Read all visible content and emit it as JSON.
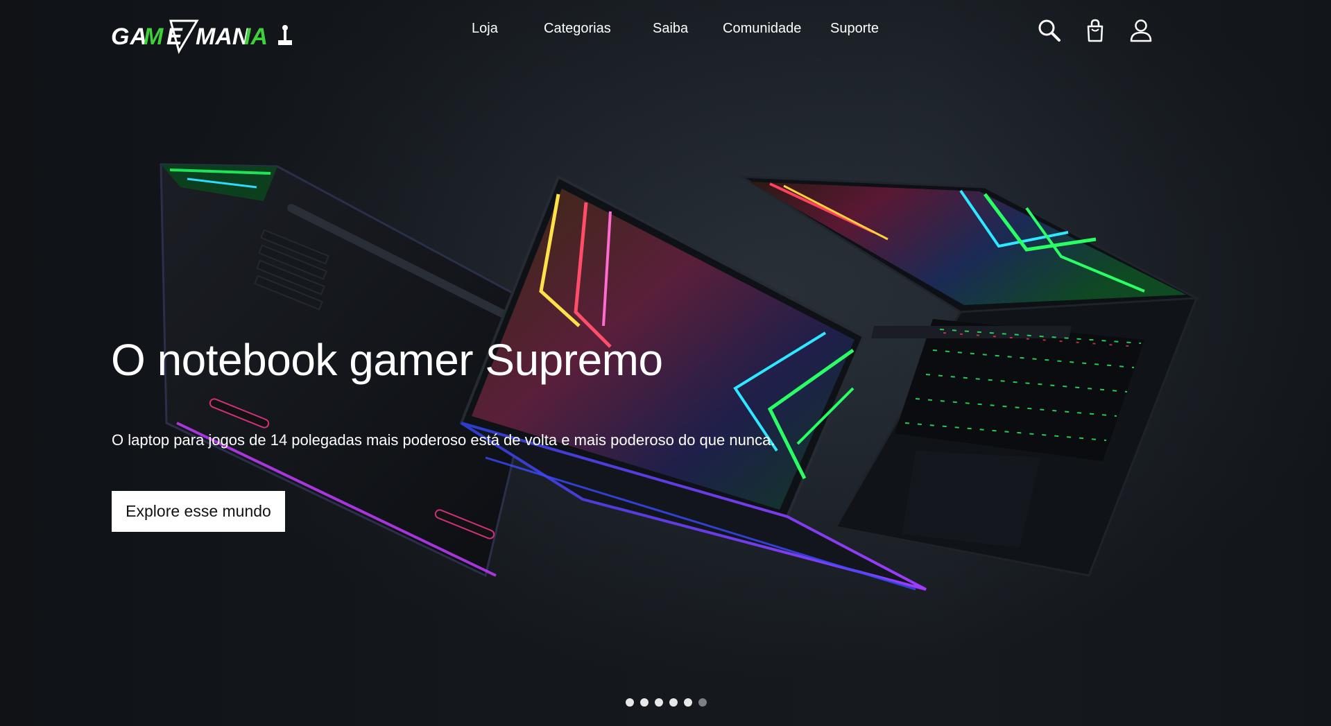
{
  "brand": {
    "name": "GAME MANIA",
    "logo_text_left": "GAME",
    "logo_text_right": "MANIA",
    "accent_color": "#3fd13b"
  },
  "nav": {
    "items": [
      {
        "label": "Loja"
      },
      {
        "label": "Categorias"
      },
      {
        "label": "Saiba"
      },
      {
        "label": "Comunidade"
      },
      {
        "label": "Suporte"
      }
    ]
  },
  "header_icons": {
    "search": "search-icon",
    "cart": "shopping-bag-icon",
    "account": "user-icon"
  },
  "hero": {
    "title": "O notebook gamer Supremo",
    "subtitle": "O laptop para jogos de 14 polegadas mais poderoso está de volta e mais poderoso do que nunca.",
    "cta_label": "Explore esse mundo"
  },
  "carousel": {
    "total_slides": 6,
    "active_slides_shown": 5
  }
}
